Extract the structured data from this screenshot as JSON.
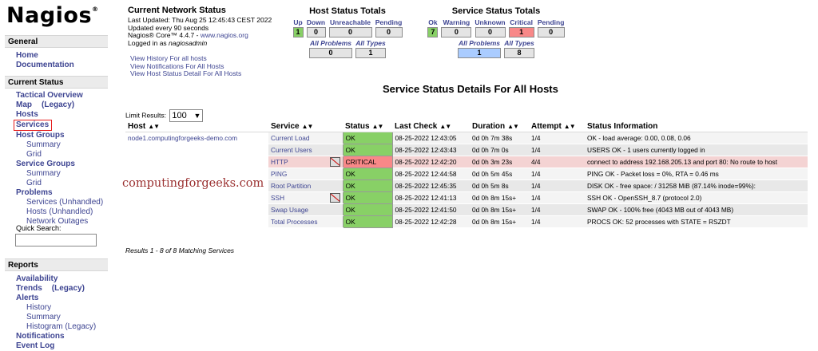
{
  "logo": {
    "text": "Nagios",
    "mark": "®"
  },
  "sidebar": {
    "general": {
      "heading": "General",
      "items": [
        "Home",
        "Documentation"
      ]
    },
    "current_status": {
      "heading": "Current Status",
      "tactical": "Tactical Overview",
      "map": "Map",
      "map_legacy": "(Legacy)",
      "hosts": "Hosts",
      "services": "Services",
      "host_groups": "Host Groups",
      "hg_summary": "Summary",
      "hg_grid": "Grid",
      "service_groups": "Service Groups",
      "sg_summary": "Summary",
      "sg_grid": "Grid",
      "problems": "Problems",
      "p_services": "Services",
      "p_hosts": "Hosts",
      "unhandled": "(Unhandled)",
      "network_outages": "Network Outages",
      "quick_search_label": "Quick Search:"
    },
    "reports": {
      "heading": "Reports",
      "availability": "Availability",
      "trends": "Trends",
      "trends_legacy": "(Legacy)",
      "alerts": "Alerts",
      "history": "History",
      "summary": "Summary",
      "histogram": "Histogram (Legacy)",
      "notifications": "Notifications",
      "event_log": "Event Log"
    }
  },
  "network_status": {
    "title": "Current Network Status",
    "last_updated": "Last Updated: Thu Aug 25 12:45:43 CEST 2022",
    "interval": "Updated every 90 seconds",
    "core_prefix": "Nagios® Core™ 4.4.7 - ",
    "core_link": "www.nagios.org",
    "logged_prefix": "Logged in as ",
    "user": "nagiosadmin",
    "links": [
      "View History For all hosts",
      "View Notifications For All Hosts",
      "View Host Status Detail For All Hosts"
    ]
  },
  "host_totals": {
    "title": "Host Status Totals",
    "labels": [
      "Up",
      "Down",
      "Unreachable",
      "Pending"
    ],
    "values": [
      "1",
      "0",
      "0",
      "0"
    ],
    "problem_labels": [
      "All Problems",
      "All Types"
    ],
    "problem_values": [
      "0",
      "1"
    ]
  },
  "service_totals": {
    "title": "Service Status Totals",
    "labels": [
      "Ok",
      "Warning",
      "Unknown",
      "Critical",
      "Pending"
    ],
    "values": [
      "7",
      "0",
      "0",
      "1",
      "0"
    ],
    "problem_labels": [
      "All Problems",
      "All Types"
    ],
    "problem_values": [
      "1",
      "8"
    ]
  },
  "table": {
    "title": "Service Status Details For All Hosts",
    "limit_label": "Limit Results:",
    "limit_value": "100",
    "headers": [
      "Host",
      "Service",
      "Status",
      "Last Check",
      "Duration",
      "Attempt",
      "Status Information"
    ],
    "host": "node1.computingforgeeks-demo.com",
    "rows": [
      {
        "service": "Current Load",
        "status": "OK",
        "last_check": "08-25-2022 12:43:05",
        "duration": "0d 0h 7m 38s",
        "attempt": "1/4",
        "info": "OK - load average: 0.00, 0.08, 0.06"
      },
      {
        "service": "Current Users",
        "status": "OK",
        "last_check": "08-25-2022 12:43:43",
        "duration": "0d 0h 7m 0s",
        "attempt": "1/4",
        "info": "USERS OK - 1 users currently logged in"
      },
      {
        "service": "HTTP",
        "status": "CRITICAL",
        "last_check": "08-25-2022 12:42:20",
        "duration": "0d 0h 3m 23s",
        "attempt": "4/4",
        "info": "connect to address 192.168.205.13 and port 80: No route to host"
      },
      {
        "service": "PING",
        "status": "OK",
        "last_check": "08-25-2022 12:44:58",
        "duration": "0d 0h 5m 45s",
        "attempt": "1/4",
        "info": "PING OK - Packet loss = 0%, RTA = 0.46 ms"
      },
      {
        "service": "Root Partition",
        "status": "OK",
        "last_check": "08-25-2022 12:45:35",
        "duration": "0d 0h 5m 8s",
        "attempt": "1/4",
        "info": "DISK OK - free space: / 31258 MiB (87.14% inode=99%):"
      },
      {
        "service": "SSH",
        "status": "OK",
        "last_check": "08-25-2022 12:41:13",
        "duration": "0d 0h 8m 15s+",
        "attempt": "1/4",
        "info": "SSH OK - OpenSSH_8.7 (protocol 2.0)"
      },
      {
        "service": "Swap Usage",
        "status": "OK",
        "last_check": "08-25-2022 12:41:50",
        "duration": "0d 0h 8m 15s+",
        "attempt": "1/4",
        "info": "SWAP OK - 100% free (4043 MB out of 4043 MB)"
      },
      {
        "service": "Total Processes",
        "status": "OK",
        "last_check": "08-25-2022 12:42:28",
        "duration": "0d 0h 8m 15s+",
        "attempt": "1/4",
        "info": "PROCS OK: 52 processes with STATE = RSZDT"
      }
    ],
    "results": "Results 1 - 8 of 8 Matching Services"
  },
  "watermark": "computingforgeeks.com"
}
